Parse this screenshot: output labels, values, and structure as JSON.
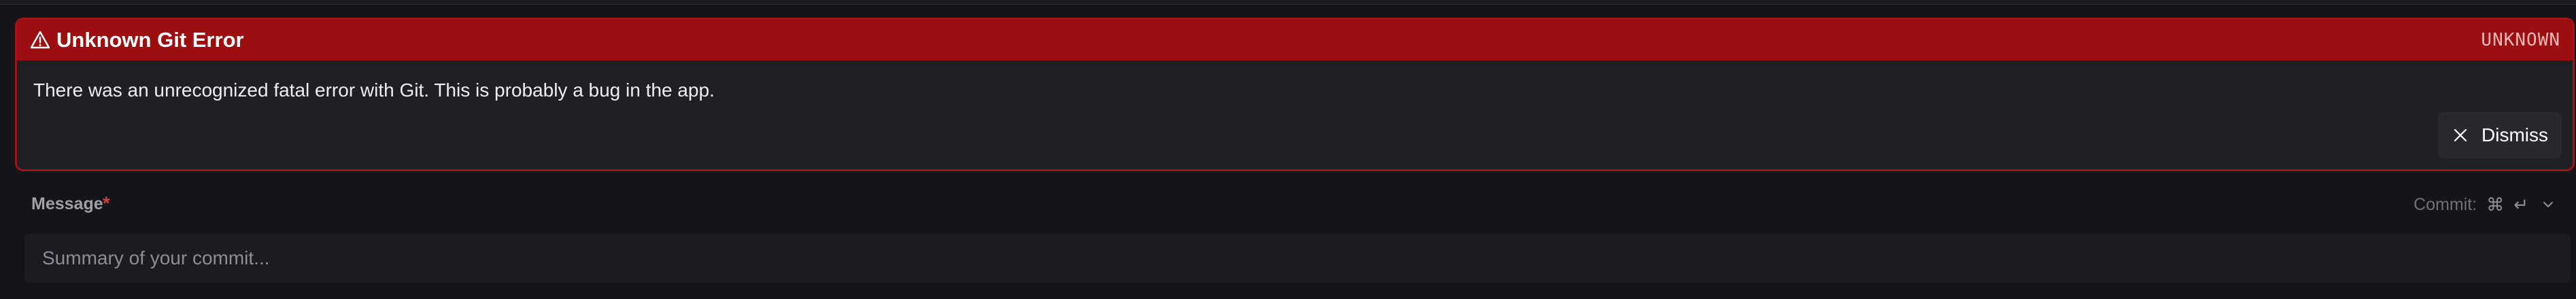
{
  "error": {
    "title": "Unknown Git Error",
    "code": "UNKNOWN",
    "message": "There was an unrecognized fatal error with Git. This is probably a bug in the app.",
    "dismiss_label": "Dismiss",
    "icon": "warning-triangle-icon",
    "colors": {
      "header_background": "#9d0e10",
      "border": "#a31216",
      "card_background": "#1f2024"
    }
  },
  "commit_form": {
    "message_label": "Message",
    "required_marker": "*",
    "shortcut_hint": "Commit:",
    "shortcut_keys": [
      "⌘",
      "↵"
    ],
    "summary_placeholder": "Summary of your commit...",
    "summary_value": ""
  }
}
